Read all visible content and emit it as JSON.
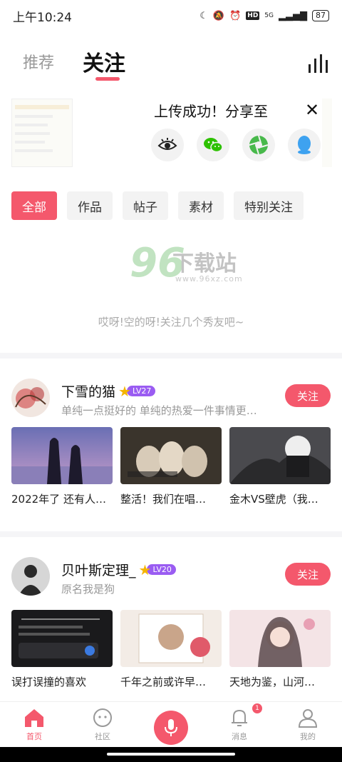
{
  "status": {
    "time": "上午10:24",
    "battery": "87",
    "network": "5G",
    "hd": "HD"
  },
  "tabs": {
    "recommend": "推荐",
    "following": "关注"
  },
  "share": {
    "title": "上传成功！分享至"
  },
  "filters": [
    "全部",
    "作品",
    "帖子",
    "素材",
    "特别关注"
  ],
  "empty": {
    "message": "哎呀!空的呀!关注几个秀友吧~"
  },
  "watermark": {
    "num": "96",
    "text": "下载站",
    "url": "www.96xz.com"
  },
  "users": [
    {
      "name": "下雪的猫",
      "level": "LV27",
      "signature": "单纯一点挺好的 单纯的热爱一件事情更…",
      "follow_label": "关注",
      "works": [
        "2022年了 还有人…",
        "整活！我们在唱…",
        "金木VS壁虎（我…"
      ]
    },
    {
      "name": "贝叶斯定理_",
      "level": "LV20",
      "signature": "原名我是狗",
      "follow_label": "关注",
      "works": [
        "误打误撞的喜欢",
        "千年之前或许早…",
        "天地为鉴，山河…"
      ]
    }
  ],
  "nav": {
    "home": "首页",
    "community": "社区",
    "messages": "消息",
    "messages_badge": "1",
    "mine": "我的"
  },
  "colors": {
    "accent": "#f4586c",
    "level_purple": "#9a5cf2"
  }
}
